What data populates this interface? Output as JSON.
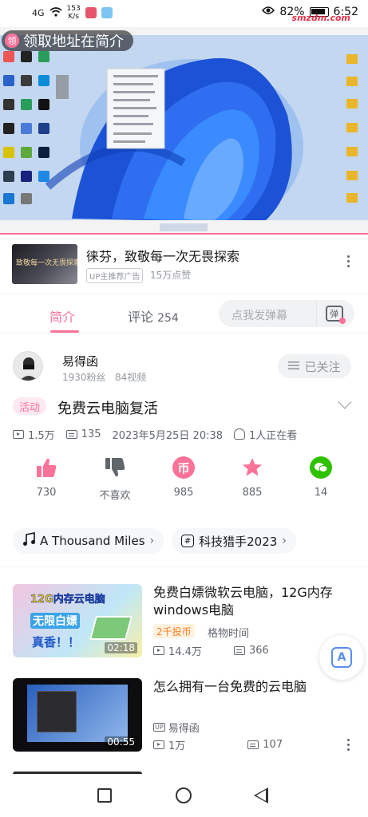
{
  "status_bar": {
    "signal": "4G",
    "net_speed_value": "153",
    "net_speed_unit": "K/s",
    "battery": "82%",
    "time": "6:52",
    "watermark": "smzdm.com"
  },
  "player": {
    "claim_badge": "领",
    "claim_label": "领取地址在简介"
  },
  "ad": {
    "thumb_text": "致敬每一次无畏探索",
    "title": "徕芬，致敬每一次无畏探索",
    "tag": "UP主推荐广告",
    "views": "15万点赞"
  },
  "tabs": {
    "intro": "简介",
    "comments": "评论",
    "comment_count": "254",
    "danmaku_placeholder": "点我发弹幕",
    "danmaku_icon": "弹"
  },
  "uploader": {
    "name": "易得函",
    "followers": "1930粉丝",
    "videos": "84视频",
    "follow_label": "已关注"
  },
  "video": {
    "activity_tag": "活动",
    "title": "免费云电脑复活",
    "views": "1.5万",
    "danmaku": "135",
    "date": "2023年5月25日 20:38",
    "watching": "1人正在看"
  },
  "actions": [
    {
      "label": "730",
      "icon": "thumb-up-icon"
    },
    {
      "label": "不喜欢",
      "icon": "thumb-down-icon"
    },
    {
      "label": "985",
      "icon": "coin-icon"
    },
    {
      "label": "885",
      "icon": "star-icon"
    },
    {
      "label": "14",
      "icon": "wechat-icon"
    }
  ],
  "chips": {
    "music": "A Thousand Miles",
    "topic": "科技猎手2023"
  },
  "recommendations": [
    {
      "thumb_line1": "12G内存云电脑",
      "thumb_line2": "无限白嫖",
      "thumb_line3": "真香！！",
      "duration": "02:18",
      "title": "免费白嫖微软云电脑，12G内存windows电脑",
      "badge": "2千投币",
      "source": "格物时间",
      "views": "14.4万",
      "danmaku": "366"
    },
    {
      "duration": "00:55",
      "title": "怎么拥有一台免费的云电脑",
      "up_tag": "UP",
      "uploader": "易得函",
      "views": "1万",
      "danmaku": "107"
    }
  ],
  "colors": {
    "accent": "#fb7299",
    "coin": "#fb7299",
    "star": "#fb7299",
    "wechat": "#2dc100"
  }
}
